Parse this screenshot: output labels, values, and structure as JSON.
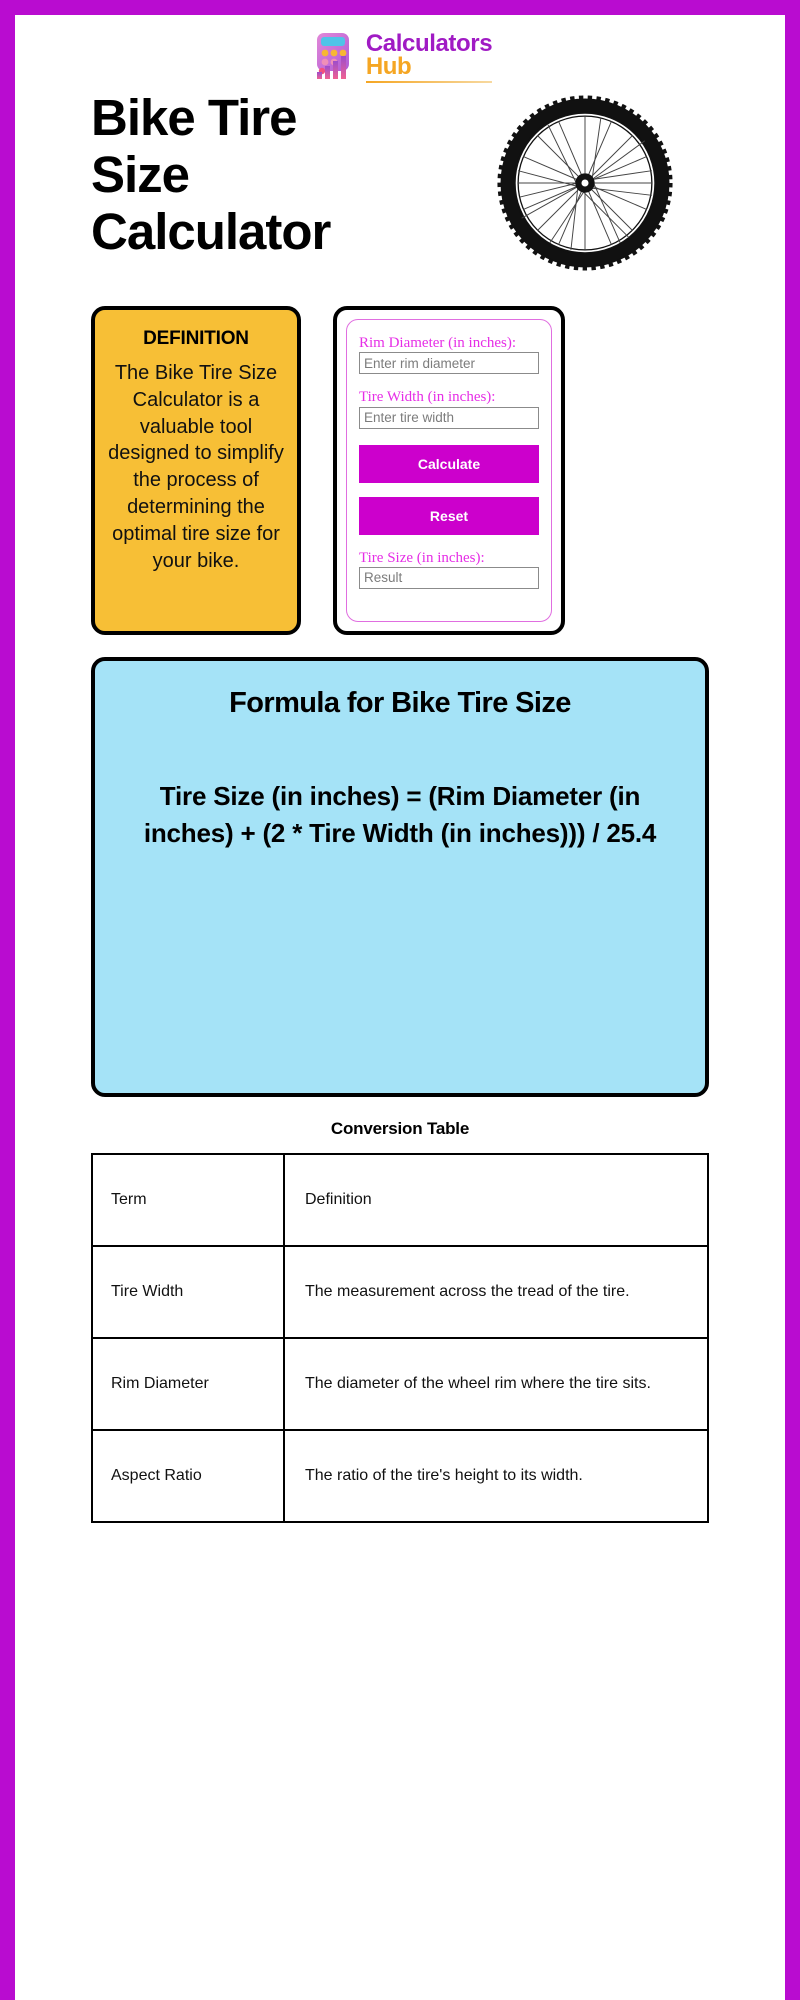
{
  "brand": {
    "logo_line1": "Calculators",
    "logo_line2": "Hub",
    "logo_icon": "calculator-bars-icon",
    "accent_purple": "#a01bc4",
    "accent_orange": "#f5a623",
    "frame_color": "#b90cd0"
  },
  "header": {
    "title": "Bike Tire Size Calculator",
    "hero_icon": "bike-wheel-icon"
  },
  "definition_card": {
    "heading": "DEFINITION",
    "body": "The Bike Tire Size Calculator is a valuable tool designed to simplify the process of determining the optimal tire size for your bike.",
    "background": "#f7bf36"
  },
  "calculator": {
    "fields": [
      {
        "label": "Rim Diameter (in inches):",
        "placeholder": "Enter rim diameter",
        "value": ""
      },
      {
        "label": "Tire Width (in inches):",
        "placeholder": "Enter tire width",
        "value": ""
      }
    ],
    "calculate_label": "Calculate",
    "reset_label": "Reset",
    "result_label": "Tire Size (in inches):",
    "result_placeholder": "Result",
    "result_value": "",
    "button_color": "#cc00cc",
    "label_color": "#e62ee6"
  },
  "formula": {
    "title": "Formula for Bike Tire Size",
    "body": "Tire Size (in inches) = (Rim Diameter (in inches) + (2 * Tire Width (in inches))) / 25.4",
    "background": "#a5e3f7"
  },
  "conversion_table": {
    "title": "Conversion Table",
    "columns": [
      "Term",
      "Definition"
    ],
    "rows": [
      [
        "Tire Width",
        "The measurement across the tread of the tire."
      ],
      [
        "Rim Diameter",
        "The diameter of the wheel rim where the tire sits."
      ],
      [
        "Aspect Ratio",
        "The ratio of the tire's height to its width."
      ]
    ]
  }
}
